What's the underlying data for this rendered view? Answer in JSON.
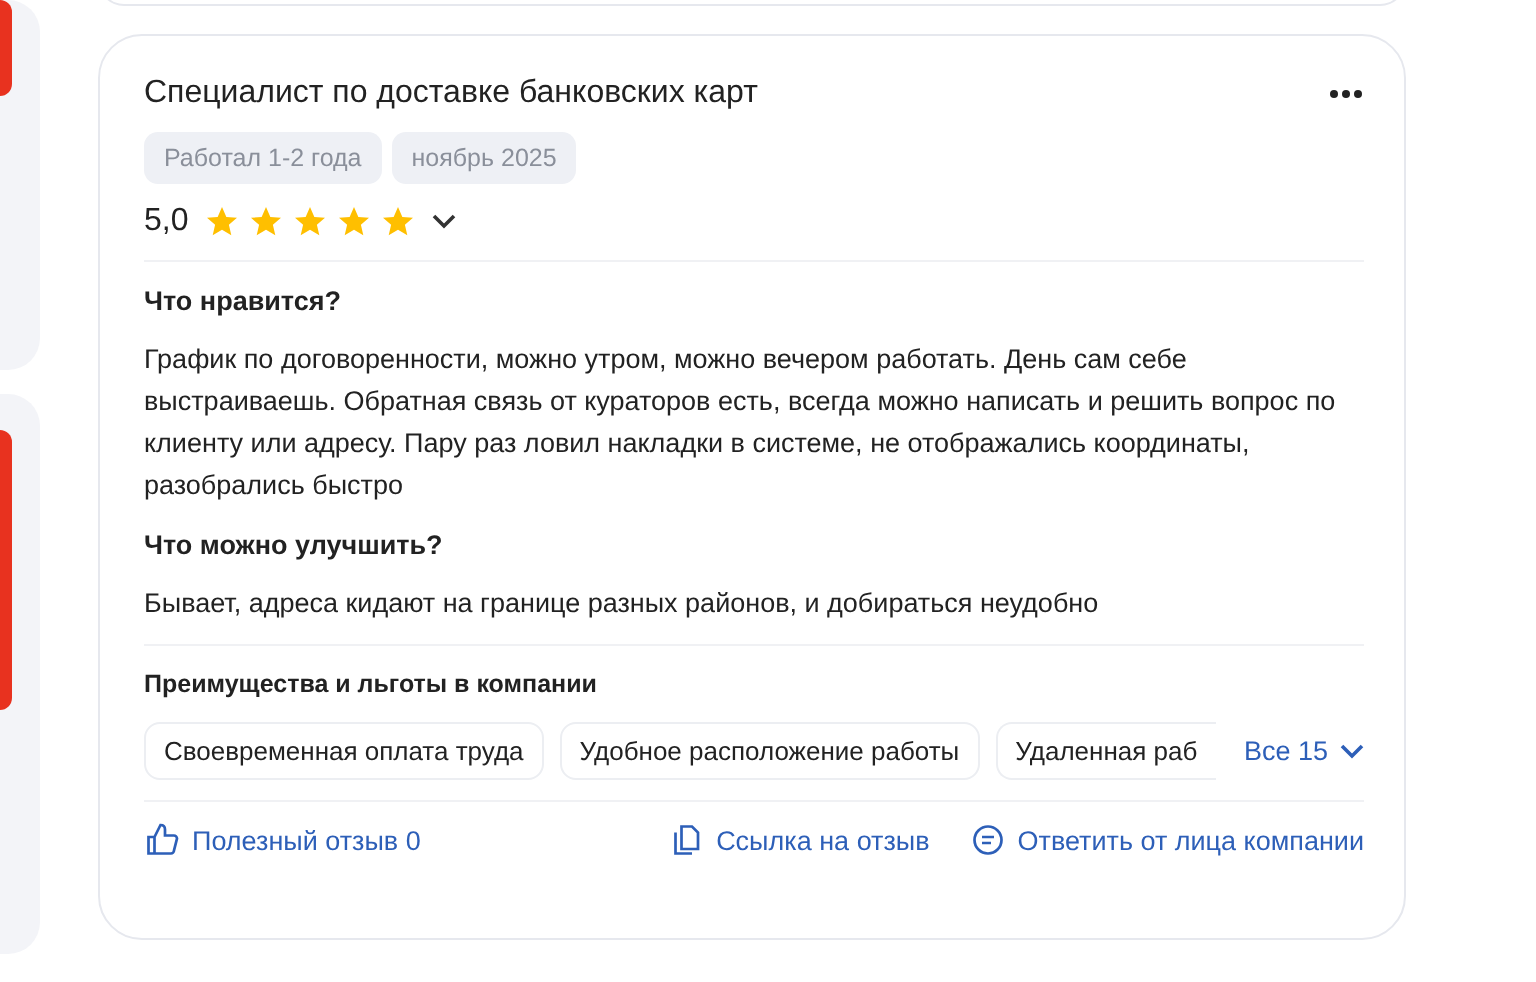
{
  "review": {
    "title": "Специалист по доставке банковских карт",
    "tags": [
      "Работал 1-2 года",
      "ноябрь 2025"
    ],
    "rating": "5,0",
    "stars": 5,
    "sections": [
      {
        "heading": "Что нравится?",
        "text": "График по договоренности, можно утром, можно вечером работать. День сам себе выстраиваешь. Обратная связь от кураторов есть, всегда можно написать и решить вопрос по клиенту или адресу. Пару раз ловил накладки в системе, не отображались координаты, разобрались быстро"
      },
      {
        "heading": "Что можно улучшить?",
        "text": "Бывает, адреса кидают на границе разных районов, и добираться неудобно"
      }
    ],
    "benefits_heading": "Преимущества и льготы в компании",
    "benefits": [
      "Своевременная оплата труда",
      "Удобное расположение работы",
      "Удаленная раб"
    ],
    "benefits_more": "Все 15",
    "actions": [
      {
        "kind": "like",
        "label": "Полезный отзыв 0"
      },
      {
        "kind": "link",
        "label": "Ссылка на отзыв"
      },
      {
        "kind": "reply",
        "label": "Ответить от лица компании"
      }
    ]
  }
}
